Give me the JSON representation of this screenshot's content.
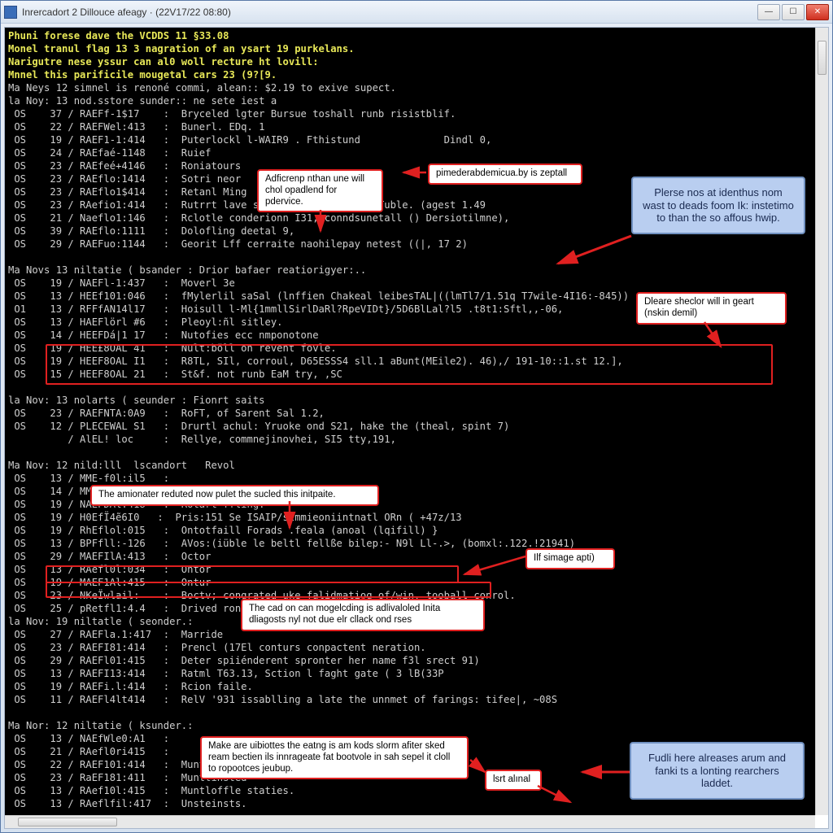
{
  "window": {
    "title": "Inrercadort 2 Dillouce afeagy · (22V17/22 08:80)"
  },
  "console_lines": [
    {
      "cls": "hdr",
      "text": "Phuni forese dave the VCDDS 11 §33.08"
    },
    {
      "cls": "hdr",
      "text": "Monel tranul flag 13 3 nagration of an ysart 19 purkelans."
    },
    {
      "cls": "hdr",
      "text": "Narigutre nese yssur can al0 woll recture ht lovill:"
    },
    {
      "cls": "hdr",
      "text": "Mnnel this parificile mougetal cars 23 (9?[9."
    },
    {
      "cls": "",
      "text": "Ma Neys 12 simnel is renoné commi, alean:: $2.19 to exive supect."
    },
    {
      "cls": "",
      "text": "la Noy: 13 nod.sstore sunder:: ne sete iest a"
    },
    {
      "cls": "",
      "text": " OS    37 / RAEFf-1$17    :  Bryceled lgter Bursue toshall runb risistblif."
    },
    {
      "cls": "",
      "text": " OS    22 / RAEFWel:413   :  Bunerl. EDq. 1"
    },
    {
      "cls": "",
      "text": " OS    19 / RAEF1-1:414   :  Puterlockl l-WAIR9 . Fthistund              Dindl 0,"
    },
    {
      "cls": "",
      "text": " OS    24 / RAEfaé-1148   :  Ruief"
    },
    {
      "cls": "",
      "text": " OS    23 / RAEfeé+4146   :  Roniatours"
    },
    {
      "cls": "",
      "text": " OS    23 / RAEflo:1414   :  Sotri neor"
    },
    {
      "cls": "",
      "text": " OS    23 / RAEflo1$414   :  Retanl Ming"
    },
    {
      "cls": "",
      "text": " OS    23 / RAefio1:414   :  Rutrrt lave shep:,'alterolection Tuble. (agest 1.49"
    },
    {
      "cls": "",
      "text": " OS    21 / Naeflo1:146   :  Rclotle conderionn I31, conndsunetall () Dersiotilmne),"
    },
    {
      "cls": "",
      "text": " OS    39 / RAEflo:1111   :  Dolofling deetal 9,"
    },
    {
      "cls": "",
      "text": " OS    29 / RAEFuo:1144   :  Georit Lff cerraite naohilepay netest ((|, 17 2)"
    },
    {
      "cls": "",
      "text": ""
    },
    {
      "cls": "",
      "text": "Ma Novs 13 niltatie ( bsander : Drior bafaer reatiorigyer:.."
    },
    {
      "cls": "",
      "text": " OS    19 / NAEFl-1:437   :  Moverl 3e"
    },
    {
      "cls": "",
      "text": " OS    13 / HEEf101:046   :  fMylerlil saSal (lnffien Chakeal leibesTAL|((lmTl7/1.51q T7wile-4I16:-845))"
    },
    {
      "cls": "",
      "text": " O1    13 / RFFfAN14l17   :  Hoisull l-Ml{1mmllSirlDaRl?RpeVIDt}/5D6BlLal?l5 .t8t1:Sftl,,-06,"
    },
    {
      "cls": "",
      "text": " OS    13 / HAEFlörl #6   :  Pleoyl:ñl sitley."
    },
    {
      "cls": "",
      "text": " OS    14 / HEEFDá|1 17   :  Nutofies ecc nmponotone"
    },
    {
      "cls": "",
      "text": " OS    19 / HEE£8OAL 41   :  Nult:böll on revent fovle."
    },
    {
      "cls": "",
      "text": " OS    19 / HEEF8OAL I1   :  R8TL, SIl, corroul, D65ESSS4 sll.1 aBunt(MEile2). 46),/ 191-10::1.st 12.],"
    },
    {
      "cls": "",
      "text": " OS    15 / HEEF8OAL 21   :  St&f. not runb EaM try, ,SC"
    },
    {
      "cls": "",
      "text": ""
    },
    {
      "cls": "",
      "text": "la Nov: 13 nolarts ( seunder : Fionrt saits"
    },
    {
      "cls": "",
      "text": " OS    23 / RAEFNTA:0A9   :  RoFT, of Sarent Sal 1.2,"
    },
    {
      "cls": "",
      "text": " OS    12 / PLECEWAL S1   :  Drurtl achul: Yruoke ond S21, hake the (theal, spint 7)"
    },
    {
      "cls": "",
      "text": "          / AlEL! loc     :  Rellye, commnejinovhei, SI5 tty,191,"
    },
    {
      "cls": "",
      "text": ""
    },
    {
      "cls": "",
      "text": "Ma Nov: 12 nild:lll  lscandort   Revol"
    },
    {
      "cls": "",
      "text": " OS    13 / MME-f0l:il5   :"
    },
    {
      "cls": "",
      "text": " OS    14 / MMEfl0l:1l1   :  Deverd clarog."
    },
    {
      "cls": "",
      "text": " OS    19 / NAEFDAl:418   :  Rotart ffling."
    },
    {
      "cls": "",
      "text": " OS    19 / H0EfÏ4̃e6I0   :  Pris:151 Se ISAIP/slmmieoniintnatl ORn ( +47z/13"
    },
    {
      "cls": "",
      "text": " OS    19 / RhEflol:015   :  Ontotfaill Forads .feala (anoal (lqifill) }"
    },
    {
      "cls": "",
      "text": " OS    13 / BPFfll:-126   :  AVos:(iüble le beltl fellße bilep:- N9l Ll-.>, (bomxl:.122.!21941)"
    },
    {
      "cls": "",
      "text": " OS    29 / MAEFIlA:413   :  Octor"
    },
    {
      "cls": "",
      "text": " OS    13 / RAefl0l:034   :  Ontor"
    },
    {
      "cls": "",
      "text": " OS    19 / MAEF1Al:415   :  Ontur"
    },
    {
      "cls": "",
      "text": " OS    23 / NKeÏwlail:    :  Boctv; congrated uke falidmatiog of/win, tooball conrol."
    },
    {
      "cls": "",
      "text": " OS    25 / pRetfl1:4.4   :  Drived ronopated, seflers,nesf of & puinetior:"
    },
    {
      "cls": "",
      "text": "la Nov: 19 niltatle ( seonder.:"
    },
    {
      "cls": "",
      "text": " OS    27 / RAEFla.1:417  :  Marride"
    },
    {
      "cls": "",
      "text": " OS    23 / RAEFI81:414   :  Prencl (17El conturs conpactent neration."
    },
    {
      "cls": "",
      "text": " OS    29 / RAEFl01:415   :  Deter spiiénderent spronter her name f3l srect 91)"
    },
    {
      "cls": "",
      "text": " OS    13 / RAEFI13:414   :  Ratml T63.13, Sction l faght gate ( 3 lB(33P"
    },
    {
      "cls": "",
      "text": " OS    19 / RAEFi.l:414   :  Rcion faile."
    },
    {
      "cls": "",
      "text": " OS    11 / RAEFl4lt414   :  RelV '931 issablling a late the unnmet of farings: tifee|, ~08S"
    },
    {
      "cls": "",
      "text": ""
    },
    {
      "cls": "",
      "text": "Ma Nor: 12 niltatie ( ksunder.:"
    },
    {
      "cls": "",
      "text": " OS    13 / NAEfWle0:A1   :"
    },
    {
      "cls": "",
      "text": " OS    21 / RAefl0ri415   :"
    },
    {
      "cls": "",
      "text": " OS    22 / RAEF101:414   :  Muntoiad can fist to chickagy deintir."
    },
    {
      "cls": "",
      "text": " OS    23 / RaEF181:411   :  Munttinsted"
    },
    {
      "cls": "",
      "text": " OS    13 / RAef10l:415   :  Muntloffle staties."
    },
    {
      "cls": "",
      "text": " OS    13 / RAeflfil:417  :  Unsteinsts."
    }
  ],
  "callouts": {
    "c1": "Adficrenp nthan une will chol opadlend for pdervice.",
    "c2": "pimederabdemicua.by is zeptall",
    "c3": "Plerse nos at identhus nom wast to deads foom Ik: instetimo to than the so affous hwip.",
    "c4": "Dleare sheclor will in geart (nskin demil)",
    "c5": "The amionater reduted now pulet the sucled this initpaite.",
    "c6": "Ilf simage apti)",
    "c7": "The cad on can mogelcding is adlivaloled Inita dliagosts nyl not due elr cllack ond rses",
    "c8": "Make are uibiottes the eatng is am kods slorm afiter sked ream bectien ils innrageate fat bootvole in sah sepel it cloll to ropootces jeubup.",
    "c9": "lsrt alınal",
    "c10": "Fudli here alreases arum and fanki ts a lonting rearchers laddet."
  }
}
